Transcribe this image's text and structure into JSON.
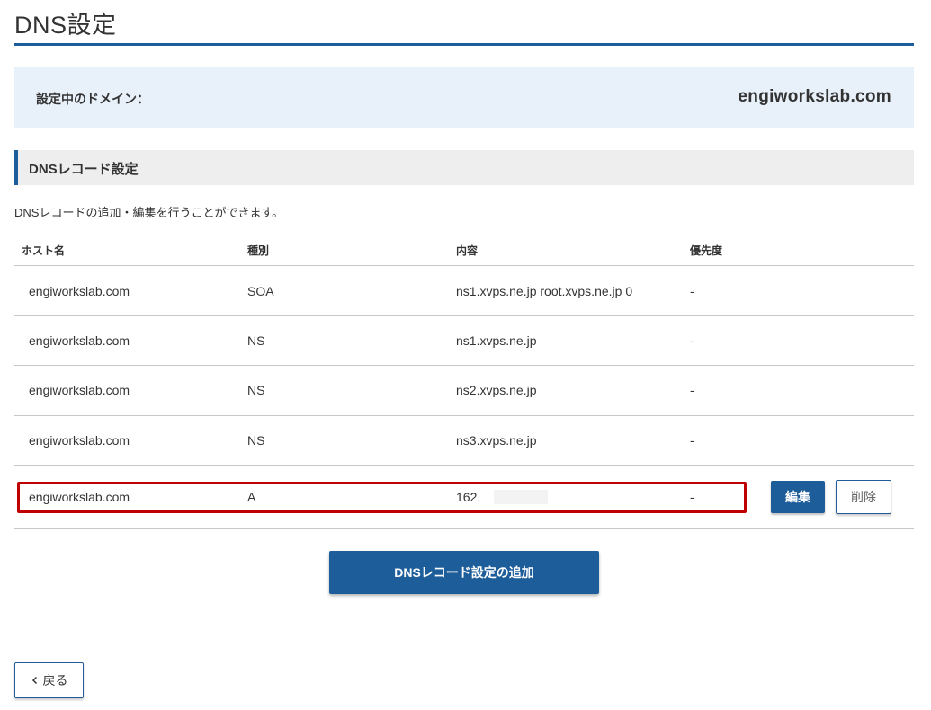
{
  "page": {
    "title": "DNS設定"
  },
  "domain": {
    "label": "設定中のドメイン：",
    "value": "engiworkslab.com"
  },
  "section": {
    "title": "DNSレコード設定",
    "description": "DNSレコードの追加・編集を行うことができます。"
  },
  "table": {
    "headers": [
      "ホスト名",
      "種別",
      "内容",
      "優先度"
    ],
    "rows": [
      {
        "host": "engiworkslab.com",
        "type": "SOA",
        "content": "ns1.xvps.ne.jp root.xvps.ne.jp 0",
        "priority": "-"
      },
      {
        "host": "engiworkslab.com",
        "type": "NS",
        "content": "ns1.xvps.ne.jp",
        "priority": "-"
      },
      {
        "host": "engiworkslab.com",
        "type": "NS",
        "content": "ns2.xvps.ne.jp",
        "priority": "-"
      },
      {
        "host": "engiworkslab.com",
        "type": "NS",
        "content": "ns3.xvps.ne.jp",
        "priority": "-"
      },
      {
        "host": "engiworkslab.com",
        "type": "A",
        "content": "162.",
        "priority": "-",
        "edit_label": "編集",
        "delete_label": "削除"
      }
    ]
  },
  "buttons": {
    "add_label": "DNSレコード設定の追加",
    "back_label": "戻る",
    "back_icon": "chevron-left-icon"
  },
  "colors": {
    "accent": "#1d5d99",
    "highlight": "#c00000",
    "domain_bg": "#e8f0fa"
  }
}
